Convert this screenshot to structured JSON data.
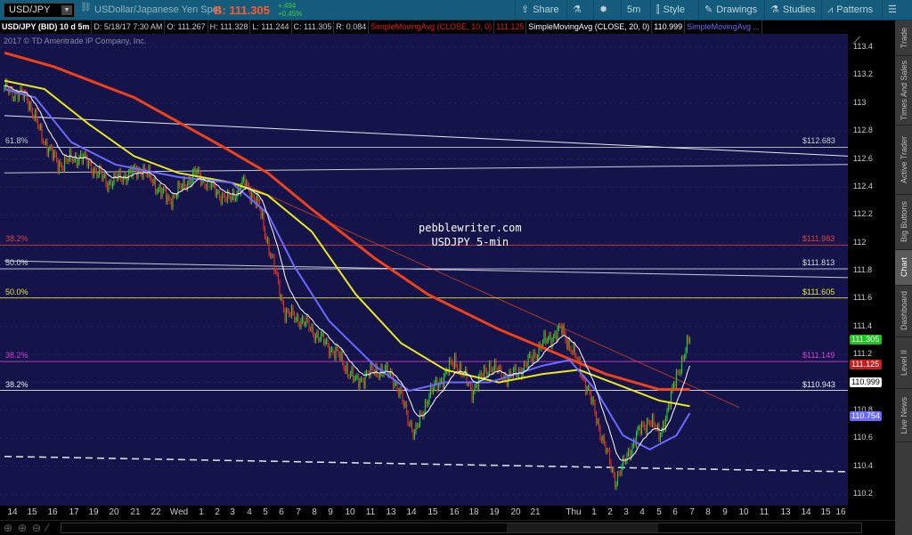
{
  "toolbar": {
    "symbol": "USD/JPY",
    "description": "USDollar/Japanese Yen Spot",
    "bid": "B: 111.305",
    "change": "+.494",
    "change_pct": "+0.45%",
    "share": "Share",
    "timeframe": "5m",
    "style": "Style",
    "drawings": "Drawings",
    "studies": "Studies",
    "patterns": "Patterns"
  },
  "infobar": {
    "title": "USD/JPY (BID) 10 d 5m",
    "date": "D: 5/18/17 7:30 AM",
    "open": "O: 111.267",
    "high": "H: 111.328",
    "low": "L: 111.244",
    "close": "C: 111.305",
    "range": "R: 0.084",
    "sma1": "SimpleMovingAvg (CLOSE, 10, 0)",
    "sma1_val": "111.125",
    "sma2": "SimpleMovingAvg (CLOSE, 20, 0)",
    "sma2_val": "110.999",
    "sma3": "SimpleMovingAvg ..."
  },
  "copyright": "2017 © TD Ameritrade IP Company, Inc.",
  "watermark": {
    "line1": "pebblewriter.com",
    "line2": "USDJPY 5-min"
  },
  "side_tabs": [
    "Trade",
    "Times And Sales",
    "Active Trader",
    "Big Buttons",
    "Chart",
    "Dashboard",
    "Level II",
    "Live News"
  ],
  "fib_levels": [
    {
      "label": "61.8%",
      "price_label": "$112.683",
      "price": 112.683,
      "color": "#cccccc"
    },
    {
      "label": "38.2%",
      "price_label": "$111.983",
      "price": 111.983,
      "color": "#e04040"
    },
    {
      "label": "50.0%",
      "price_label": "$111.813",
      "price": 111.813,
      "color": "#dddddd"
    },
    {
      "label": "50.0%",
      "price_label": "$111.605",
      "price": 111.605,
      "color": "#e8e830"
    },
    {
      "label": "38.2%",
      "price_label": "$111.149",
      "price": 111.149,
      "color": "#d040d0"
    },
    {
      "label": "38.2%",
      "price_label": "$110.943",
      "price": 110.943,
      "color": "#eeeeee"
    }
  ],
  "price_tags": [
    {
      "text": "111.305",
      "price": 111.305,
      "bg": "#1fc41f",
      "fg": "#fff"
    },
    {
      "text": "111.125",
      "price": 111.125,
      "bg": "#c41f1f",
      "fg": "#fff"
    },
    {
      "text": "110.999",
      "price": 110.999,
      "bg": "#ffffff",
      "fg": "#000"
    },
    {
      "text": "110.754",
      "price": 110.754,
      "bg": "#6a6aff",
      "fg": "#fff"
    }
  ],
  "chart_data": {
    "type": "candlestick",
    "title": "USD/JPY (BID) 10 d 5m",
    "y_ticks": [
      "113.4",
      "113.2",
      "113",
      "112.8",
      "112.6",
      "112.4",
      "112.2",
      "112",
      "111.8",
      "111.6",
      "111.4",
      "111.2",
      "111",
      "110.8",
      "110.6",
      "110.4",
      "110.2"
    ],
    "ylim": [
      110.1,
      113.5
    ],
    "x_ticks": [
      "14",
      "15",
      "16",
      "17",
      "19",
      "20",
      "21",
      "22",
      "Wed",
      "1",
      "2",
      "3",
      "4",
      "5",
      "6",
      "7",
      "8",
      "9",
      "10",
      "11",
      "13",
      "14",
      "15",
      "16",
      "18",
      "19",
      "20",
      "21",
      "Thu",
      "1",
      "2",
      "3",
      "4",
      "5",
      "6",
      "7",
      "8",
      "9",
      "10",
      "11",
      "13",
      "14",
      "15",
      "16"
    ],
    "price_path": [
      [
        0,
        113.1
      ],
      [
        17,
        113.04
      ],
      [
        27,
        112.78
      ],
      [
        40,
        112.56
      ],
      [
        57,
        112.62
      ],
      [
        77,
        112.43
      ],
      [
        103,
        112.53
      ],
      [
        123,
        112.3
      ],
      [
        143,
        112.5
      ],
      [
        167,
        112.3
      ],
      [
        180,
        112.43
      ],
      [
        190,
        112.27
      ],
      [
        200,
        111.89
      ],
      [
        210,
        111.5
      ],
      [
        223,
        111.44
      ],
      [
        237,
        111.31
      ],
      [
        250,
        111.19
      ],
      [
        263,
        111.0
      ],
      [
        277,
        111.09
      ],
      [
        290,
        111.06
      ],
      [
        300,
        110.81
      ],
      [
        307,
        110.62
      ],
      [
        317,
        110.9
      ],
      [
        330,
        111.06
      ],
      [
        337,
        111.16
      ],
      [
        350,
        110.94
      ],
      [
        363,
        111.12
      ],
      [
        377,
        111.03
      ],
      [
        390,
        111.12
      ],
      [
        403,
        111.28
      ],
      [
        417,
        111.38
      ],
      [
        427,
        111.19
      ],
      [
        437,
        110.94
      ],
      [
        450,
        110.52
      ],
      [
        457,
        110.3
      ],
      [
        463,
        110.4
      ],
      [
        473,
        110.62
      ],
      [
        483,
        110.74
      ],
      [
        490,
        110.62
      ],
      [
        497,
        110.81
      ],
      [
        503,
        111.06
      ],
      [
        509,
        111.19
      ],
      [
        513,
        111.32
      ]
    ],
    "ma_red": [
      [
        0,
        113.36
      ],
      [
        37,
        113.26
      ],
      [
        97,
        113.04
      ],
      [
        163,
        112.69
      ],
      [
        197,
        112.5
      ],
      [
        230,
        112.24
      ],
      [
        277,
        111.89
      ],
      [
        317,
        111.63
      ],
      [
        370,
        111.38
      ],
      [
        410,
        111.22
      ],
      [
        450,
        111.06
      ],
      [
        490,
        110.95
      ],
      [
        513,
        110.95
      ]
    ],
    "ma_yellow": [
      [
        0,
        113.16
      ],
      [
        30,
        113.1
      ],
      [
        63,
        112.85
      ],
      [
        97,
        112.62
      ],
      [
        130,
        112.5
      ],
      [
        170,
        112.43
      ],
      [
        197,
        112.34
      ],
      [
        230,
        112.08
      ],
      [
        263,
        111.63
      ],
      [
        297,
        111.28
      ],
      [
        330,
        111.09
      ],
      [
        370,
        111.0
      ],
      [
        403,
        111.06
      ],
      [
        430,
        111.09
      ],
      [
        463,
        110.97
      ],
      [
        490,
        110.87
      ],
      [
        513,
        110.83
      ]
    ],
    "ma_blue": [
      [
        0,
        113.1
      ],
      [
        23,
        113.04
      ],
      [
        50,
        112.72
      ],
      [
        83,
        112.56
      ],
      [
        130,
        112.47
      ],
      [
        170,
        112.43
      ],
      [
        197,
        112.21
      ],
      [
        217,
        111.83
      ],
      [
        243,
        111.44
      ],
      [
        277,
        111.12
      ],
      [
        303,
        110.94
      ],
      [
        330,
        111.0
      ],
      [
        363,
        111.0
      ],
      [
        403,
        111.12
      ],
      [
        423,
        111.16
      ],
      [
        443,
        110.94
      ],
      [
        463,
        110.62
      ],
      [
        483,
        110.52
      ],
      [
        503,
        110.62
      ],
      [
        513,
        110.78
      ]
    ],
    "trendlines": [
      {
        "from": [
          0,
          112.91
        ],
        "to": [
          632,
          112.62
        ],
        "color": "#ffffff",
        "style": "solid"
      },
      {
        "from": [
          0,
          112.5
        ],
        "to": [
          632,
          112.56
        ],
        "color": "#dddddd",
        "style": "solid"
      },
      {
        "from": [
          0,
          111.87
        ],
        "to": [
          632,
          111.75
        ],
        "color": "#dddddd",
        "style": "solid"
      },
      {
        "from": [
          0,
          110.47
        ],
        "to": [
          632,
          110.36
        ],
        "color": "#ffffff",
        "style": "dashed"
      },
      {
        "from": [
          177,
          112.43
        ],
        "to": [
          550,
          110.82
        ],
        "color": "#d04020",
        "style": "solid"
      }
    ]
  }
}
